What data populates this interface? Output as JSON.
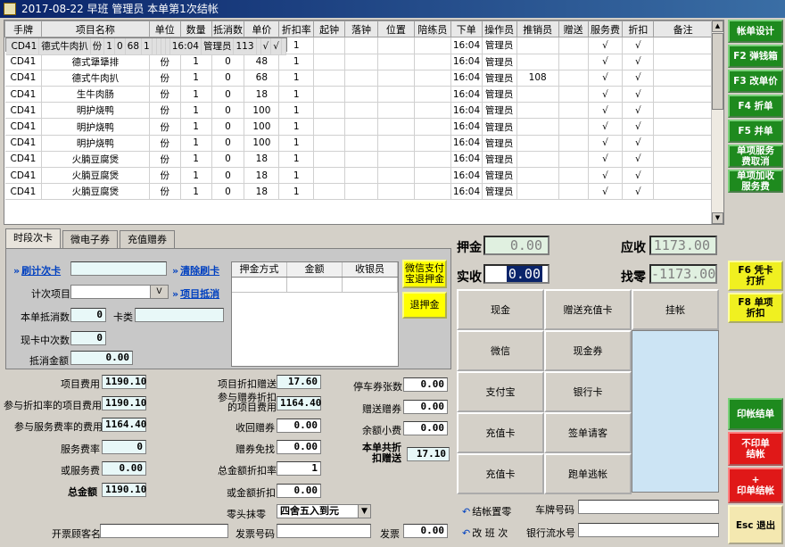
{
  "title": "2017-08-22 早班 管理员 本单第1次结帐",
  "grid": {
    "columns": [
      "手牌",
      "项目名称",
      "单位",
      "数量",
      "抵消数",
      "单价",
      "折扣率",
      "起钟",
      "落钟",
      "位置",
      "陪练员",
      "下单",
      "操作员",
      "推销员",
      "赠送",
      "服务费",
      "折扣",
      "备注"
    ],
    "rows": [
      [
        "CD41",
        "德式牛肉扒",
        "份",
        "1",
        "0",
        "68",
        "1",
        "",
        "",
        "",
        "",
        "16:04",
        "管理员",
        "113",
        "",
        "√",
        "√",
        ""
      ],
      [
        "CD41",
        "德式犟犟排",
        "份",
        "1",
        "0",
        "48",
        "1",
        "",
        "",
        "",
        "",
        "16:04",
        "管理员",
        "",
        "",
        "√",
        "√",
        ""
      ],
      [
        "CD41",
        "德式犟犟排",
        "份",
        "1",
        "0",
        "48",
        "1",
        "",
        "",
        "",
        "",
        "16:04",
        "管理员",
        "",
        "",
        "√",
        "√",
        ""
      ],
      [
        "CD41",
        "德式牛肉扒",
        "份",
        "1",
        "0",
        "68",
        "1",
        "",
        "",
        "",
        "",
        "16:04",
        "管理员",
        "108",
        "",
        "√",
        "√",
        ""
      ],
      [
        "CD41",
        "生牛肉肠",
        "份",
        "1",
        "0",
        "18",
        "1",
        "",
        "",
        "",
        "",
        "16:04",
        "管理员",
        "",
        "",
        "√",
        "√",
        ""
      ],
      [
        "CD41",
        "明护烧鸭",
        "份",
        "1",
        "0",
        "100",
        "1",
        "",
        "",
        "",
        "",
        "16:04",
        "管理员",
        "",
        "",
        "√",
        "√",
        ""
      ],
      [
        "CD41",
        "明护烧鸭",
        "份",
        "1",
        "0",
        "100",
        "1",
        "",
        "",
        "",
        "",
        "16:04",
        "管理员",
        "",
        "",
        "√",
        "√",
        ""
      ],
      [
        "CD41",
        "明护烧鸭",
        "份",
        "1",
        "0",
        "100",
        "1",
        "",
        "",
        "",
        "",
        "16:04",
        "管理员",
        "",
        "",
        "√",
        "√",
        ""
      ],
      [
        "CD41",
        "火腩豆腐煲",
        "份",
        "1",
        "0",
        "18",
        "1",
        "",
        "",
        "",
        "",
        "16:04",
        "管理员",
        "",
        "",
        "√",
        "√",
        ""
      ],
      [
        "CD41",
        "火腩豆腐煲",
        "份",
        "1",
        "0",
        "18",
        "1",
        "",
        "",
        "",
        "",
        "16:04",
        "管理员",
        "",
        "",
        "√",
        "√",
        ""
      ],
      [
        "CD41",
        "火腩豆腐煲",
        "份",
        "1",
        "0",
        "18",
        "1",
        "",
        "",
        "",
        "",
        "16:04",
        "管理员",
        "",
        "",
        "√",
        "√",
        ""
      ]
    ]
  },
  "right_buttons": {
    "design": "帐单设计",
    "f2": "F2 弹钱箱",
    "f3": "F3 改单价",
    "f4": "F4 折单",
    "f5": "F5 并单",
    "cancel_service_1": "单项服务",
    "cancel_service_2": "费取消",
    "add_service_1": "单项加收",
    "add_service_2": "服务费",
    "f6_1": "F6 凭卡",
    "f6_2": "打折",
    "f8_1": "F8 单项",
    "f8_2": "折扣",
    "print_settle": "印帐结单",
    "noprint_1": "不印单",
    "noprint_2": "结帐",
    "print_plus_1": "+",
    "print_plus_2": "印单结帐",
    "esc": "Esc 退出"
  },
  "tabs": [
    "时段次卡",
    "微电子券",
    "充值赠券"
  ],
  "card": {
    "swipe_count_card": "刷计次卡",
    "clear_swipe": "清除刷卡",
    "count_item": "计次项目",
    "item_offset": "项目抵消",
    "offset_count_label": "本单抵消数",
    "offset_count": "0",
    "card_type_label": "卡类",
    "card_mid_label": "现卡中次数",
    "card_mid": "0",
    "offset_amount_label": "抵消金额",
    "offset_amount": "0.00"
  },
  "deposit": {
    "cols": [
      "押金方式",
      "金额",
      "收银员"
    ],
    "wechat_refund_1": "微信支付",
    "wechat_refund_2": "宝退押金",
    "refund": "退押金"
  },
  "summary": {
    "item_fee_label": "项目费用",
    "item_fee": "1190.10",
    "discount_item_fee_label": "参与折扣率的项目费用",
    "discount_item_fee": "1190.10",
    "service_rate_fee_label": "参与服务费率的费用",
    "service_rate_fee": "1164.40",
    "service_rate_label": "服务费率",
    "service_rate": "0",
    "or_service_fee_label": "或服务费",
    "or_service_fee": "0.00",
    "total_label": "总金额",
    "total": "1190.10",
    "item_discount_gift_label": "项目折扣赠送",
    "item_discount_gift": "17.60",
    "gift_discount_1": "参与赠券折扣",
    "gift_discount_2": "的项目费用",
    "gift_discount_fee": "1164.40",
    "collect_coupon_label": "收回赠券",
    "collect_coupon": "0.00",
    "coupon_free_label": "赠券免找",
    "coupon_free": "0.00",
    "total_discount_rate_label": "总金额折扣率",
    "total_discount_rate": "1",
    "or_total_discount_label": "或金额折扣",
    "or_total_discount": "0.00",
    "parking_label": "停车券张数",
    "parking": "0.00",
    "gift_coupon_label": "赠送赠券",
    "gift_coupon": "0.00",
    "balance_tip_label": "余额小费",
    "balance_tip": "0.00",
    "total_discount_1": "本单共折",
    "total_discount_2": "扣赠送",
    "total_discount": "17.10",
    "rounding_label": "零头抹零",
    "rounding_value": "四舍五入到元",
    "invoice_name_label": "开票顾客名",
    "invoice_no_label": "发票号码",
    "invoice_label": "发票",
    "invoice": "0.00"
  },
  "pay": {
    "deposit_label": "押金",
    "deposit": "0.00",
    "receivable_label": "应收",
    "receivable": "1173.00",
    "actual_label": "实收",
    "actual": "0.00",
    "change_label": "找零",
    "change": "-1173.00",
    "buttons": [
      "现金",
      "赠送充值卡",
      "挂帐",
      "微信",
      "现金券",
      "支付宝",
      "银行卡",
      "充值卡",
      "签单请客",
      "充值卡",
      "跑单逃帐"
    ],
    "reset_label": "结帐置零",
    "rename_label": "改 班 次",
    "plate_label": "车牌号码",
    "bank_label": "银行流水号"
  }
}
